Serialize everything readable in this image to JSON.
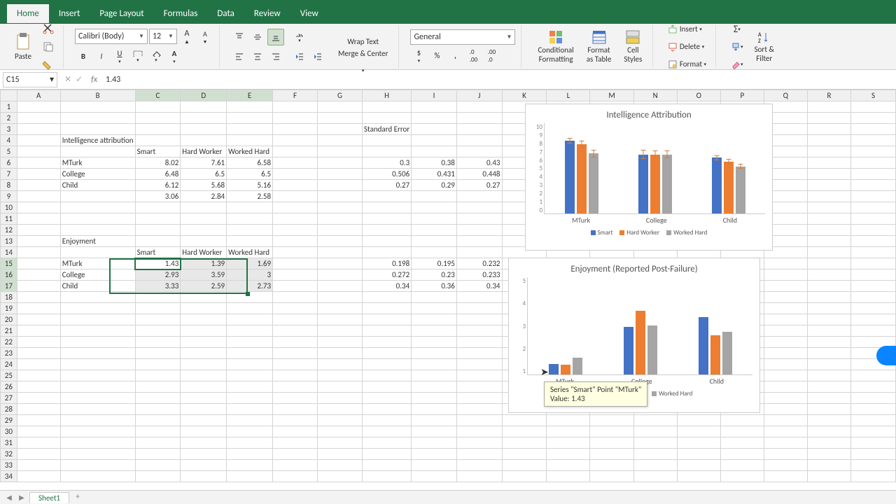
{
  "tabs": [
    "Home",
    "Insert",
    "Page Layout",
    "Formulas",
    "Data",
    "Review",
    "View"
  ],
  "active_tab": "Home",
  "font": {
    "name": "Calibri (Body)",
    "size": "12"
  },
  "number_format": "General",
  "clipboard": {
    "paste": "Paste"
  },
  "style_btns": {
    "cond": "Conditional\nFormatting",
    "table": "Format\nas Table",
    "cell": "Cell\nStyles"
  },
  "cell_ops": {
    "insert": "Insert",
    "delete": "Delete",
    "format": "Format"
  },
  "editing": {
    "sort": "Sort &\nFilter"
  },
  "align": {
    "wrap": "Wrap Text",
    "merge": "Merge & Center"
  },
  "namebox": "C15",
  "formula": "1.43",
  "columns": [
    "A",
    "B",
    "C",
    "D",
    "E",
    "F",
    "G",
    "H",
    "I",
    "J",
    "K",
    "L",
    "M",
    "N",
    "O",
    "P",
    "Q",
    "R",
    "S"
  ],
  "cells": {
    "H3": "Standard Error",
    "B4": "Intelligence attribution",
    "C5": "Smart",
    "D5": "Hard Worker",
    "E5": "Worked Hard",
    "B6": "MTurk",
    "C6": "8.02",
    "D6": "7.61",
    "E6": "6.58",
    "H6": "0.3",
    "I6": "0.38",
    "J6": "0.43",
    "B7": "College",
    "C7": "6.48",
    "D7": "6.5",
    "E7": "6.5",
    "H7": "0.506",
    "I7": "0.431",
    "J7": "0.448",
    "B8": "Child",
    "C8": "6.12",
    "D8": "5.68",
    "E8": "5.16",
    "H8": "0.27",
    "I8": "0.29",
    "J8": "0.27",
    "C9": "3.06",
    "D9": "2.84",
    "E9": "2.58",
    "B13": "Enjoyment",
    "C14": "Smart",
    "D14": "Hard Worker",
    "E14": "Worked Hard",
    "B15": "MTurk",
    "C15": "1.43",
    "D15": "1.39",
    "E15": "1.69",
    "H15": "0.198",
    "I15": "0.195",
    "J15": "0.232",
    "B16": "College",
    "C16": "2.93",
    "D16": "3.59",
    "E16": "3",
    "H16": "0.272",
    "I16": "0.23",
    "J16": "0.233",
    "B17": "Child",
    "C17": "3.33",
    "D17": "2.59",
    "E17": "2.73",
    "H17": "0.34",
    "I17": "0.36",
    "J17": "0.34"
  },
  "sheet_tab": "Sheet1",
  "tooltip": {
    "line1": "Series \"Smart\" Point \"MTurk\"",
    "line2": "Value: 1.43"
  },
  "chart_data": [
    {
      "type": "bar",
      "title": "Intelligence Attribution",
      "categories": [
        "MTurk",
        "College",
        "Child"
      ],
      "series": [
        {
          "name": "Smart",
          "values": [
            8.02,
            6.48,
            6.12
          ],
          "err": [
            0.3,
            0.506,
            0.27
          ]
        },
        {
          "name": "Hard Worker",
          "values": [
            7.61,
            6.5,
            5.68
          ],
          "err": [
            0.38,
            0.431,
            0.29
          ]
        },
        {
          "name": "Worked Hard",
          "values": [
            6.58,
            6.5,
            5.16
          ],
          "err": [
            0.43,
            0.448,
            0.27
          ]
        }
      ],
      "ylim": [
        0,
        10
      ],
      "yticks": [
        0,
        1,
        2,
        3,
        4,
        5,
        6,
        7,
        8,
        9,
        10
      ]
    },
    {
      "type": "bar",
      "title": "Enjoyment (Reported Post-Failure)",
      "categories": [
        "MTurk",
        "College",
        "Child"
      ],
      "series": [
        {
          "name": "Smart",
          "values": [
            1.43,
            2.93,
            3.33
          ]
        },
        {
          "name": "Hard Worker",
          "values": [
            1.39,
            3.59,
            2.59
          ]
        },
        {
          "name": "Worked Hard",
          "values": [
            1.69,
            3.0,
            2.73
          ]
        }
      ],
      "ylim": [
        1,
        5
      ],
      "yticks": [
        1,
        2,
        3,
        4,
        5
      ]
    }
  ]
}
